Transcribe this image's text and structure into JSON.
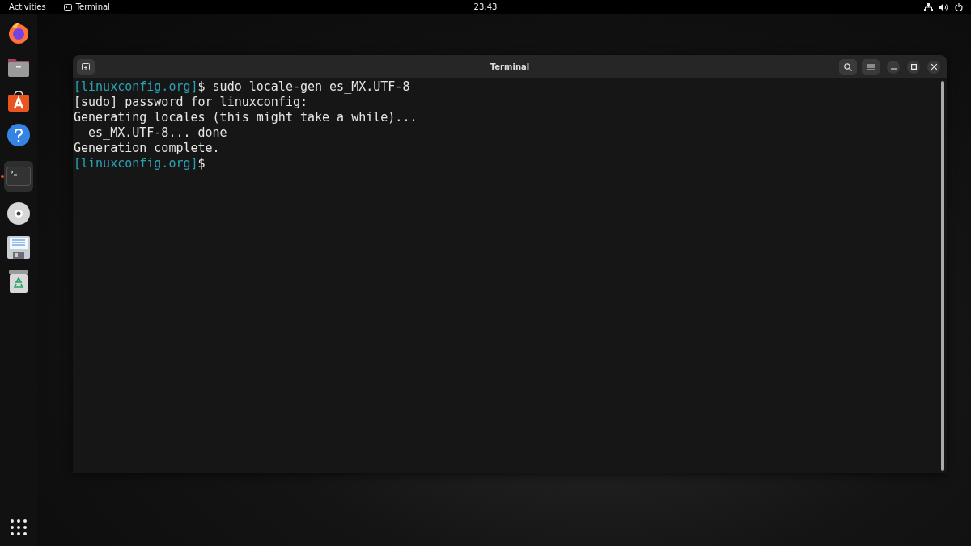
{
  "top_bar": {
    "activities": "Activities",
    "app_menu": "Terminal",
    "clock": "23:43"
  },
  "dock": {
    "favorites": [
      {
        "kind": "browser",
        "running": false
      },
      {
        "kind": "files",
        "running": false
      },
      {
        "kind": "store",
        "running": false
      },
      {
        "kind": "help",
        "running": false
      }
    ],
    "others": [
      {
        "kind": "terminal",
        "running": true
      },
      {
        "kind": "disc",
        "running": false
      },
      {
        "kind": "floppy",
        "running": false
      },
      {
        "kind": "trash",
        "running": false
      }
    ]
  },
  "window": {
    "title": "Terminal",
    "lines": [
      {
        "kind": "command",
        "prompt": "[linuxconfig.org]",
        "text": "$ sudo locale-gen es_MX.UTF-8"
      },
      {
        "kind": "output",
        "text": "[sudo] password for linuxconfig:"
      },
      {
        "kind": "output",
        "text": "Generating locales (this might take a while)..."
      },
      {
        "kind": "output",
        "text": "  es_MX.UTF-8... done"
      },
      {
        "kind": "output",
        "text": "Generation complete."
      },
      {
        "kind": "command",
        "prompt": "[linuxconfig.org]",
        "text": "$"
      }
    ]
  }
}
